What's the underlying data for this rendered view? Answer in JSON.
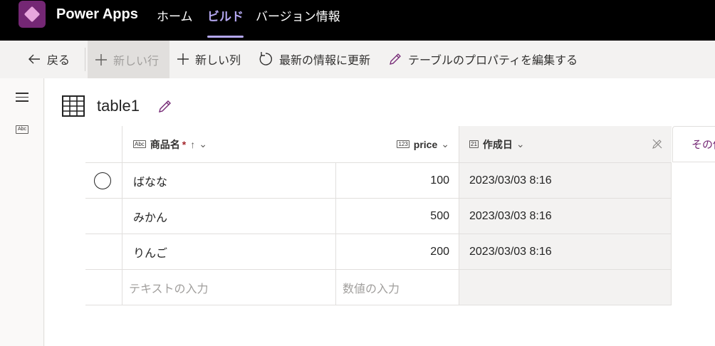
{
  "app": {
    "title": "Power Apps",
    "nav": {
      "home": "ホーム",
      "build": "ビルド",
      "version": "バージョン情報"
    }
  },
  "commands": {
    "back": "戻る",
    "new_row": "新しい行",
    "new_column": "新しい列",
    "refresh": "最新の情報に更新",
    "edit_properties": "テーブルのプロパティを編集する"
  },
  "rail": {
    "abc_label": "Abc"
  },
  "table": {
    "name": "table1",
    "columns": [
      {
        "label": "商品名",
        "type_badge": "Abc",
        "required": "*",
        "sort": "↑"
      },
      {
        "label": "price",
        "type_badge": "123"
      },
      {
        "label": "作成日",
        "type_badge": "21"
      }
    ],
    "other_tab": "その他",
    "rows": [
      {
        "name": "ばなな",
        "price": "100",
        "created": "2023/03/03 8:16"
      },
      {
        "name": "みかん",
        "price": "500",
        "created": "2023/03/03 8:16"
      },
      {
        "name": "りんご",
        "price": "200",
        "created": "2023/03/03 8:16"
      }
    ],
    "new_row_placeholders": {
      "name": "テキストの入力",
      "price": "数値の入力"
    }
  },
  "colors": {
    "accent": "#742774",
    "build_nav": "#b4a7f0",
    "topbar": "#000000"
  }
}
